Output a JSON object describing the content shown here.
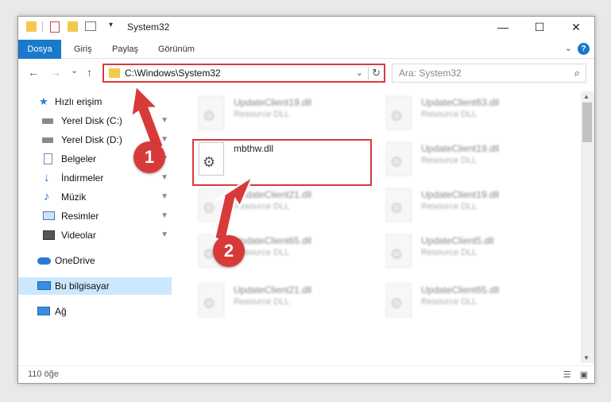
{
  "window": {
    "title": "System32",
    "controls": {
      "minimize": "—",
      "maximize": "☐",
      "close": "✕"
    }
  },
  "ribbon": {
    "tabs": [
      "Dosya",
      "Giriş",
      "Paylaş",
      "Görünüm"
    ],
    "expand_icon": "chevron-down-icon",
    "help": "?"
  },
  "navbar": {
    "back": "←",
    "forward": "→",
    "recent": "⌄",
    "up": "↑",
    "address": "C:\\Windows\\System32",
    "address_chevron": "⌄",
    "refresh": "↻",
    "search_placeholder": "Ara: System32",
    "search_icon": "⌕"
  },
  "sidebar": {
    "items": [
      {
        "label": "Hızlı erişim",
        "icon": "star-icon",
        "pinned": false
      },
      {
        "label": "Yerel Disk (C:)",
        "icon": "drive-icon",
        "pinned": true
      },
      {
        "label": "Yerel Disk (D:)",
        "icon": "drive-icon",
        "pinned": true
      },
      {
        "label": "Belgeler",
        "icon": "document-icon",
        "pinned": true
      },
      {
        "label": "İndirmeler",
        "icon": "download-icon",
        "pinned": true
      },
      {
        "label": "Müzik",
        "icon": "music-icon",
        "pinned": true
      },
      {
        "label": "Resimler",
        "icon": "pictures-icon",
        "pinned": true
      },
      {
        "label": "Videolar",
        "icon": "video-icon",
        "pinned": true
      },
      {
        "label": "OneDrive",
        "icon": "cloud-icon",
        "pinned": false
      },
      {
        "label": "Bu bilgisayar",
        "icon": "computer-icon",
        "pinned": false,
        "selected": true
      },
      {
        "label": "Ağ",
        "icon": "network-icon",
        "pinned": false
      }
    ],
    "pin_glyph": "📌"
  },
  "files": [
    {
      "name": "UpdateClient19.dll",
      "type": "Resource DLL"
    },
    {
      "name": "UpdateClient63.dll",
      "type": "Resource DLL"
    },
    {
      "name": "mbthw.dll",
      "type": ""
    },
    {
      "name": "UpdateClient19.dll",
      "type": "Resource DLL"
    },
    {
      "name": "UpdateClient21.dll",
      "type": "Resource DLL"
    },
    {
      "name": "UpdateClient19.dll",
      "type": "Resource DLL"
    },
    {
      "name": "UpdateClient65.dll",
      "type": "Resource DLL"
    },
    {
      "name": "UpdateClient5.dll",
      "type": "Resource DLL"
    },
    {
      "name": "UpdateClient21.dll",
      "type": "Resource DLL"
    },
    {
      "name": "UpdateClient65.dll",
      "type": "Resource DLL"
    }
  ],
  "status": {
    "count": "110 öğe"
  },
  "annotations": {
    "step1": "1",
    "step2": "2",
    "color": "#d83a3a"
  },
  "colors": {
    "accent": "#1979ca",
    "selected": "#cce8ff",
    "highlight": "#d83a3a"
  }
}
